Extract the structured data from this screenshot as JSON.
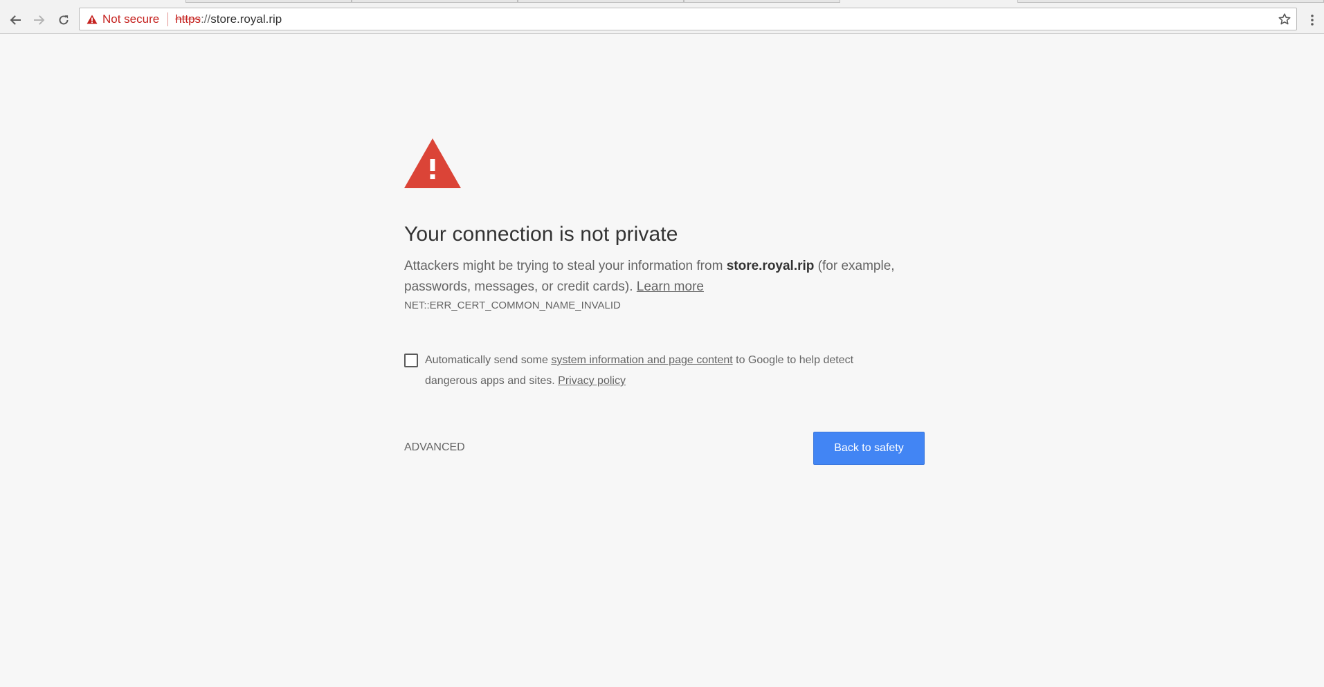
{
  "browser": {
    "security_label": "Not secure",
    "url_scheme": "https",
    "url_separator": "://",
    "url_host": "store.royal.rip"
  },
  "interstitial": {
    "heading": "Your connection is not private",
    "message_before_host": "Attackers might be trying to steal your information from ",
    "message_host": "store.royal.rip",
    "message_after_host": " (for example, passwords, messages, or credit cards). ",
    "learn_more": "Learn more",
    "error_code": "NET::ERR_CERT_COMMON_NAME_INVALID",
    "reporting_before_link": "Automatically send some ",
    "reporting_link": "system information and page content",
    "reporting_after_link": " to Google to help detect dangerous apps and sites. ",
    "privacy_policy": "Privacy policy",
    "reporting_checked": false,
    "advanced_label": "ADVANCED",
    "back_label": "Back to safety"
  },
  "icons": {
    "back": "arrow-left-icon",
    "forward": "arrow-right-icon",
    "reload": "reload-icon",
    "security": "warning-triangle-icon",
    "bookmark": "star-outline-icon",
    "menu": "kebab-menu-icon",
    "hero": "warning-triangle-icon"
  },
  "colors": {
    "accent_blue": "#4285f4",
    "warning_red": "#db4437",
    "not_secure_red": "#c5221f",
    "background": "#f7f7f7"
  }
}
